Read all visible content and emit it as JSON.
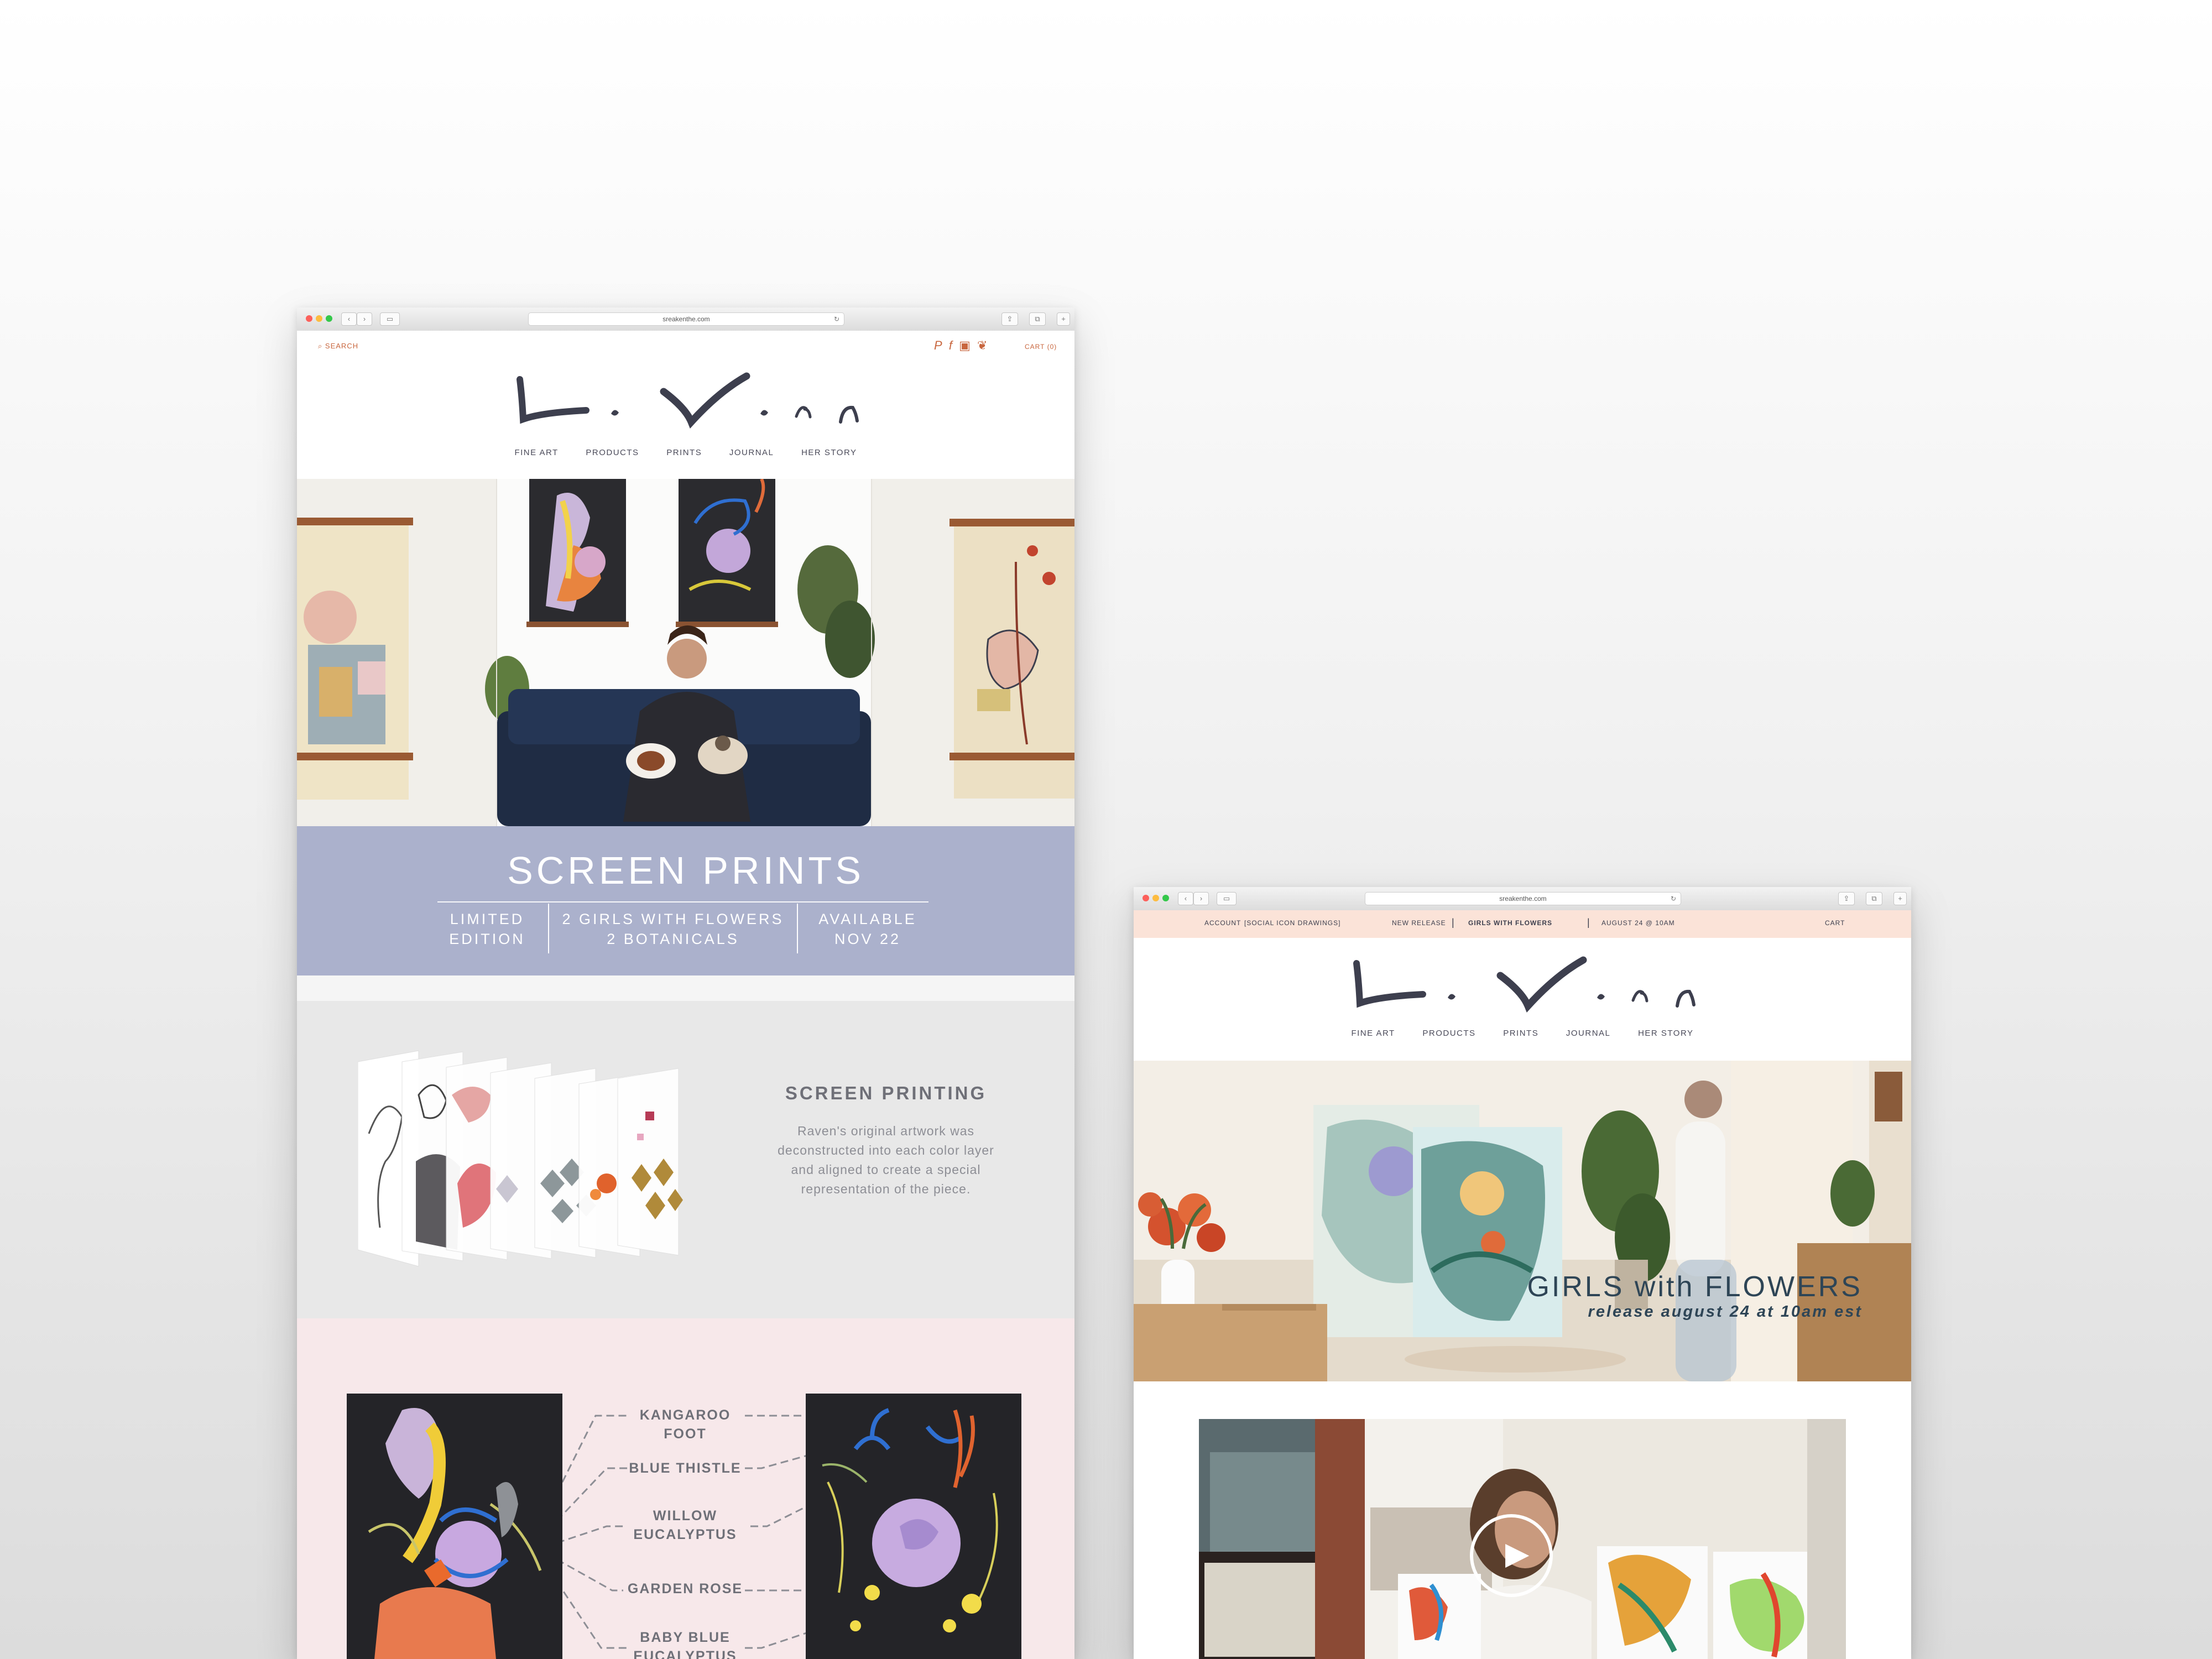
{
  "colors": {
    "accent": "#c8663e",
    "periwinkle": "#abb1cc",
    "blush": "#f7e8ea",
    "ink": "#3d3f4e",
    "peach": "#fbe3d8"
  },
  "window1": {
    "url": "sreakenthe.com",
    "header": {
      "search": "SEARCH",
      "cart": "CART (0)",
      "social_icons": [
        "pinterest-icon",
        "facebook-icon",
        "instagram-icon",
        "twitter-icon"
      ]
    },
    "nav": [
      "FINE ART",
      "PRODUCTS",
      "PRINTS",
      "JOURNAL",
      "HER STORY"
    ],
    "banner": {
      "title": "SCREEN PRINTS",
      "col1": [
        "LIMITED",
        "EDITION"
      ],
      "col2": [
        "2 GIRLS WITH FLOWERS",
        "2 BOTANICALS"
      ],
      "col3": [
        "AVAILABLE",
        "NOV 22"
      ]
    },
    "process": {
      "heading": "SCREEN PRINTING",
      "body": [
        "Raven's original artwork was",
        "deconstructed into each color layer",
        "and aligned to create a special",
        "representation of the piece."
      ]
    },
    "callouts": [
      "KANGAROO FOOT",
      "BLUE THISTLE",
      "WILLOW EUCALYPTUS",
      "GARDEN ROSE",
      "BABY BLUE EUCALYPTUS"
    ]
  },
  "window2": {
    "url": "sreakenthe.com",
    "topbar": {
      "account": "ACCOUNT",
      "social": "[SOCIAL ICON DRAWINGS]",
      "new_release": "NEW RELEASE",
      "release_name": "GIRLS WITH FLOWERS",
      "date": "AUGUST 24 @ 10AM",
      "cart": "CART"
    },
    "nav": [
      "FINE ART",
      "PRODUCTS",
      "PRINTS",
      "JOURNAL",
      "HER STORY"
    ],
    "hero": {
      "title": "GIRLS with FLOWERS",
      "subtitle": "release august 24 at 10am est"
    }
  }
}
